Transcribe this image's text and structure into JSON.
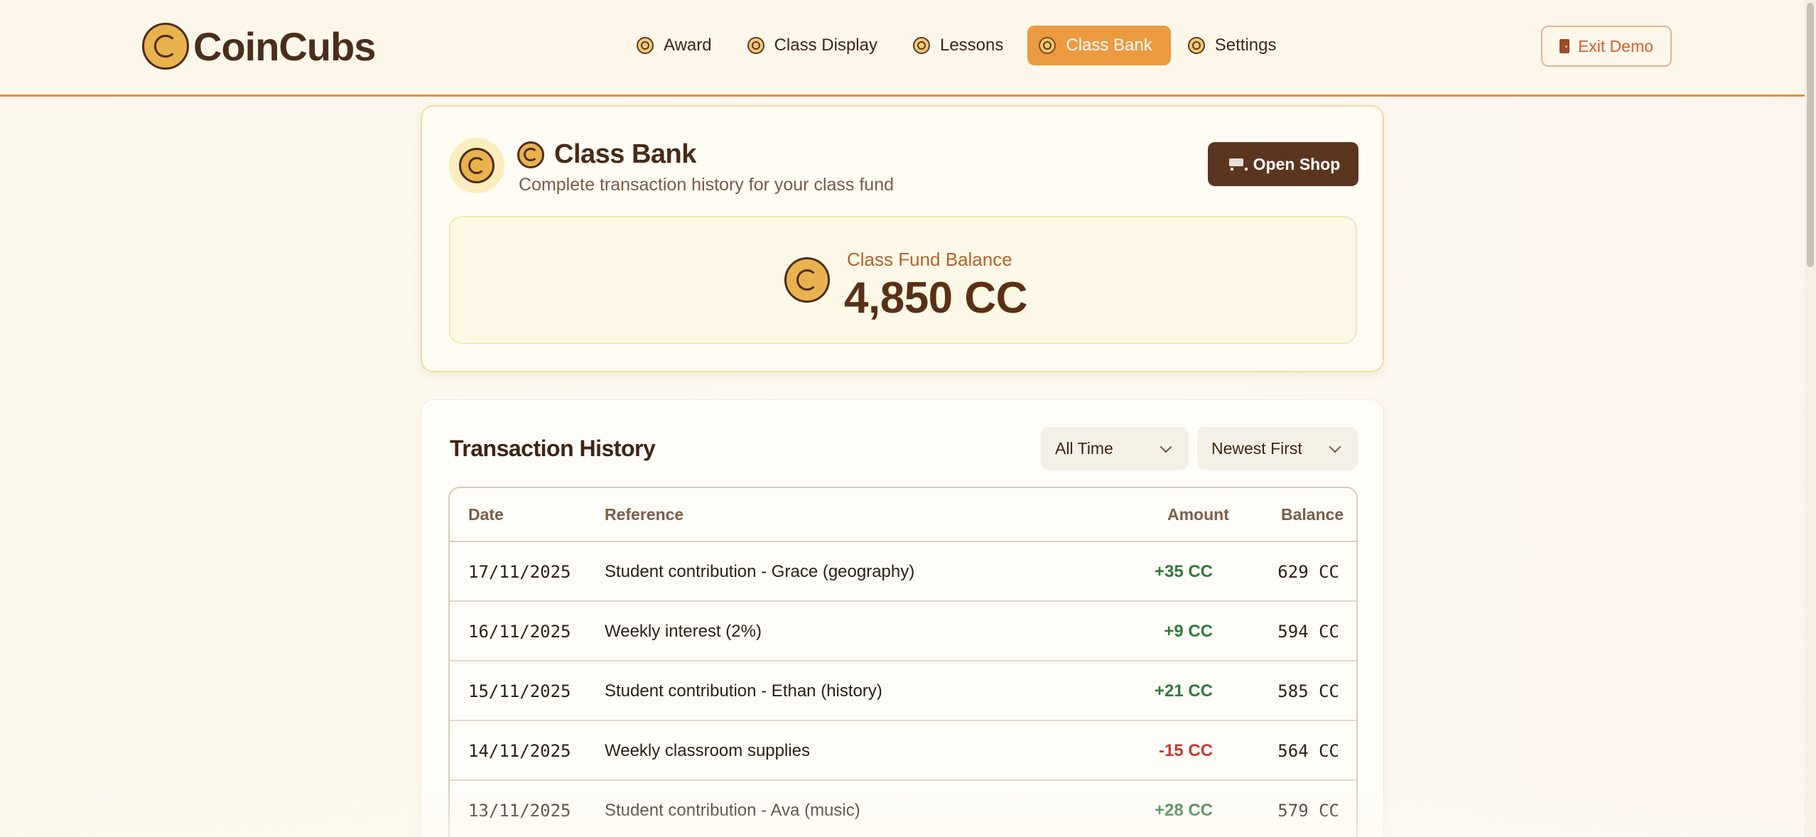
{
  "brand": {
    "name": "CoinCubs"
  },
  "nav": {
    "items": [
      {
        "label": "Award",
        "icon": "award-icon"
      },
      {
        "label": "Class Display",
        "icon": "display-icon"
      },
      {
        "label": "Lessons",
        "icon": "lessons-icon"
      },
      {
        "label": "Class Bank",
        "icon": "bank-icon",
        "active": true
      },
      {
        "label": "Settings",
        "icon": "gear-icon"
      }
    ],
    "exit_label": "Exit Demo"
  },
  "bank": {
    "title": "Class Bank",
    "subtitle": "Complete transaction history for your class fund",
    "shop_label": "Open Shop",
    "balance_label": "Class Fund Balance",
    "balance_value": "4,850 CC"
  },
  "transactions": {
    "title": "Transaction History",
    "period_filter": "All Time",
    "sort_filter": "Newest First",
    "columns": {
      "date": "Date",
      "reference": "Reference",
      "amount": "Amount",
      "balance": "Balance"
    },
    "rows": [
      {
        "date": "17/11/2025",
        "reference": "Student contribution - Grace (geography)",
        "amount": "+35 CC",
        "balance": "629 CC"
      },
      {
        "date": "16/11/2025",
        "reference": "Weekly interest (2%)",
        "amount": "+9 CC",
        "balance": "594 CC"
      },
      {
        "date": "15/11/2025",
        "reference": "Student contribution - Ethan (history)",
        "amount": "+21 CC",
        "balance": "585 CC"
      },
      {
        "date": "14/11/2025",
        "reference": "Weekly classroom supplies",
        "amount": "-15 CC",
        "balance": "564 CC"
      },
      {
        "date": "13/11/2025",
        "reference": "Student contribution - Ava (music)",
        "amount": "+28 CC",
        "balance": "579 CC"
      }
    ]
  },
  "colors": {
    "accent": "#eb9a3f",
    "brown": "#5c3520",
    "positive": "#2f7a3a",
    "negative": "#c43a32"
  }
}
